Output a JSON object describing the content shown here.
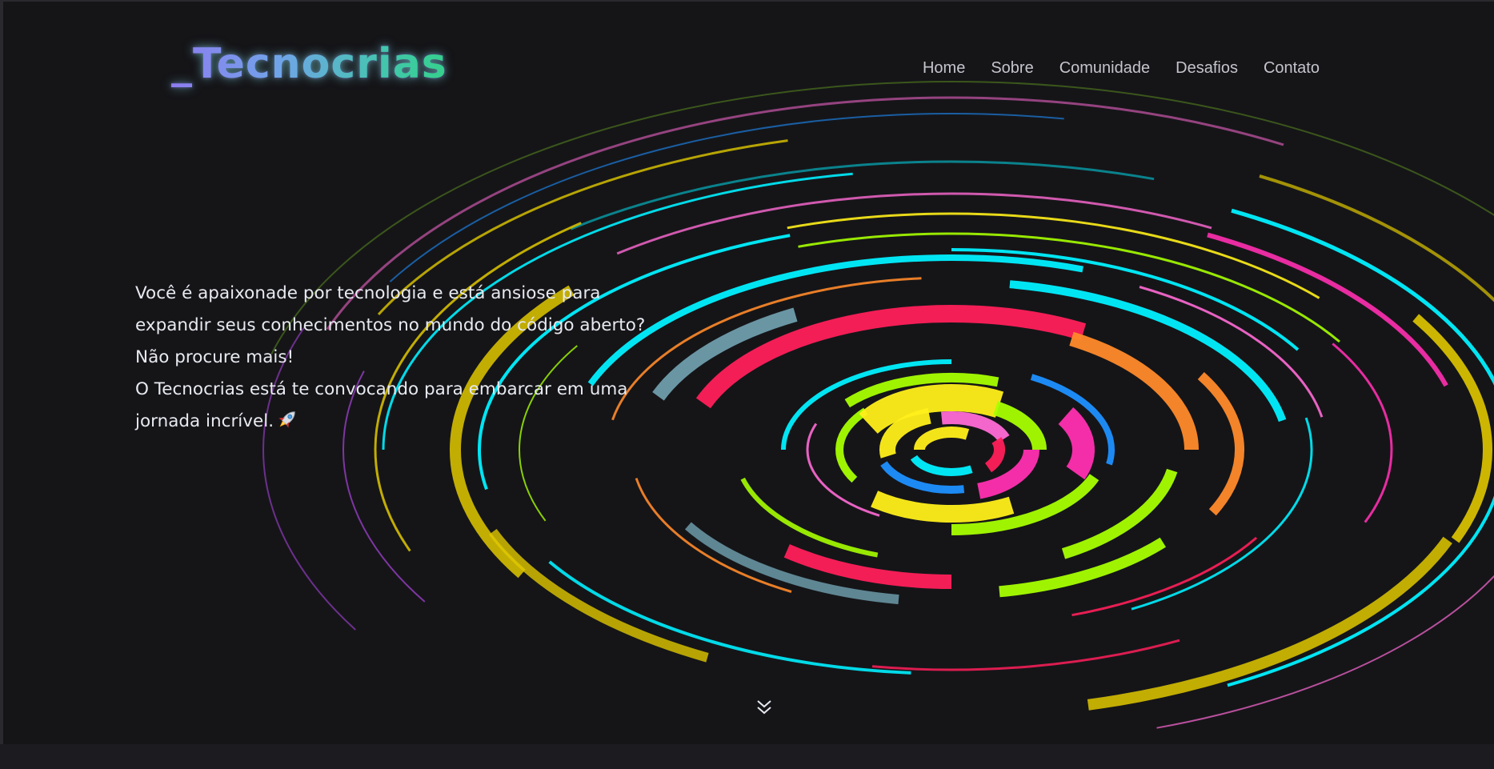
{
  "brand": {
    "logo_text": "_Tecnocrias"
  },
  "nav": {
    "items": [
      {
        "label": "Home"
      },
      {
        "label": "Sobre"
      },
      {
        "label": "Comunidade"
      },
      {
        "label": "Desafios"
      },
      {
        "label": "Contato"
      }
    ]
  },
  "hero": {
    "lines": [
      "Você é apaixonade por tecnologia e está ansiose para",
      "expandir seus conhecimentos no mundo do código aberto?",
      "Não procure mais!",
      "O Tecnocrias está te convocando para embarcar em uma",
      "jornada incrível."
    ],
    "emoji_icon": "rocket-icon",
    "scroll_icon": "double-chevron-down-icon"
  },
  "colors": {
    "background": "#151518",
    "text": "#e7eaf0",
    "nav_text": "#c4c4cc",
    "ring_palette": [
      "#ff1f5a",
      "#00f0ff",
      "#a6ff00",
      "#ff8a2a",
      "#ffef1a",
      "#ff2fb0",
      "#1e90ff",
      "#ff6ad5",
      "#e0c800",
      "#7fb6c8",
      "#c44cff"
    ]
  }
}
